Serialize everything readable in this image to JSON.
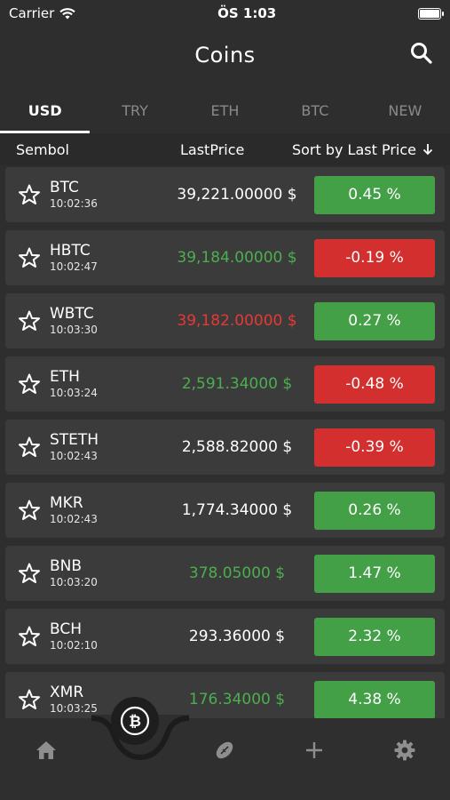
{
  "status": {
    "carrier": "Carrier",
    "time": "ÖS 1:03"
  },
  "header": {
    "title": "Coins"
  },
  "tabs": [
    "USD",
    "TRY",
    "ETH",
    "BTC",
    "NEW"
  ],
  "columns": {
    "symbol": "Sembol",
    "last_price": "LastPrice",
    "sort": "Sort by Last Price"
  },
  "coins": [
    {
      "symbol": "BTC",
      "time": "10:02:36",
      "price": "39,221.00000 $",
      "price_color": "white",
      "change": "0.45 %",
      "dir": "up"
    },
    {
      "symbol": "HBTC",
      "time": "10:02:47",
      "price": "39,184.00000 $",
      "price_color": "green",
      "change": "-0.19 %",
      "dir": "down"
    },
    {
      "symbol": "WBTC",
      "time": "10:03:30",
      "price": "39,182.00000 $",
      "price_color": "red",
      "change": "0.27 %",
      "dir": "up"
    },
    {
      "symbol": "ETH",
      "time": "10:03:24",
      "price": "2,591.34000 $",
      "price_color": "green",
      "change": "-0.48 %",
      "dir": "down"
    },
    {
      "symbol": "STETH",
      "time": "10:02:43",
      "price": "2,588.82000 $",
      "price_color": "white",
      "change": "-0.39 %",
      "dir": "down"
    },
    {
      "symbol": "MKR",
      "time": "10:02:43",
      "price": "1,774.34000 $",
      "price_color": "white",
      "change": "0.26 %",
      "dir": "up"
    },
    {
      "symbol": "BNB",
      "time": "10:03:20",
      "price": "378.05000 $",
      "price_color": "green",
      "change": "1.47 %",
      "dir": "up"
    },
    {
      "symbol": "BCH",
      "time": "10:02:10",
      "price": "293.36000 $",
      "price_color": "white",
      "change": "2.32 %",
      "dir": "up"
    },
    {
      "symbol": "XMR",
      "time": "10:03:25",
      "price": "176.34000 $",
      "price_color": "green",
      "change": "4.38 %",
      "dir": "up"
    }
  ],
  "tabbar": [
    "home-icon",
    "bitcoin-icon",
    "football-icon",
    "plus-icon",
    "gear-icon"
  ]
}
